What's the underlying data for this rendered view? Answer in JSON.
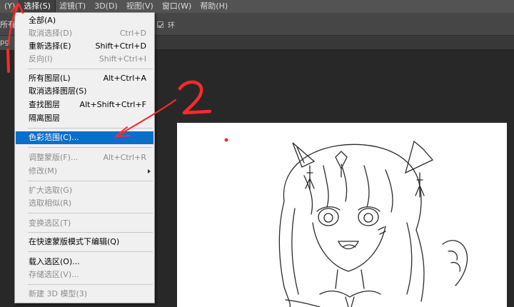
{
  "menubar": {
    "items": [
      "(Y)",
      "选择(S)",
      "滤镜(T)",
      "3D(D)",
      "视图(V)",
      "窗口(W)",
      "帮助(H)"
    ],
    "active_index": 1
  },
  "options_bar": {
    "left_text": "所有",
    "right_text": "环"
  },
  "tab": {
    "label": "pg @"
  },
  "select_menu": {
    "items": [
      {
        "label": "全部(A)",
        "shortcut": "",
        "disabled": false
      },
      {
        "label": "取消选择(D)",
        "shortcut": "Ctrl+D",
        "disabled": true
      },
      {
        "label": "重新选择(E)",
        "shortcut": "Shift+Ctrl+D",
        "disabled": false
      },
      {
        "label": "反向(I)",
        "shortcut": "Shift+Ctrl+I",
        "disabled": true
      },
      {
        "label": "所有图层(L)",
        "shortcut": "Alt+Ctrl+A",
        "disabled": false
      },
      {
        "label": "取消选择图层(S)",
        "shortcut": "",
        "disabled": false
      },
      {
        "label": "查找图层",
        "shortcut": "Alt+Shift+Ctrl+F",
        "disabled": false
      },
      {
        "label": "隔离图层",
        "shortcut": "",
        "disabled": false
      },
      {
        "label": "色彩范围(C)...",
        "shortcut": "",
        "disabled": false,
        "highlighted": true
      },
      {
        "label": "调整蒙版(F)...",
        "shortcut": "Alt+Ctrl+R",
        "disabled": true
      },
      {
        "label": "修改(M)",
        "shortcut": "",
        "disabled": true,
        "submenu": true
      },
      {
        "label": "扩大选取(G)",
        "shortcut": "",
        "disabled": true
      },
      {
        "label": "选取相似(R)",
        "shortcut": "",
        "disabled": true
      },
      {
        "label": "变换选区(T)",
        "shortcut": "",
        "disabled": true
      },
      {
        "label": "在快速蒙版模式下编辑(Q)",
        "shortcut": "",
        "disabled": false
      },
      {
        "label": "载入选区(O)...",
        "shortcut": "",
        "disabled": false
      },
      {
        "label": "存储选区(V)...",
        "shortcut": "",
        "disabled": true
      },
      {
        "label": "新建 3D 模型(3)",
        "shortcut": "",
        "disabled": true
      }
    ]
  },
  "annotations": {
    "step_1": "1",
    "step_2": "2",
    "annotation_color": "#ff2a2a"
  },
  "colors": {
    "menubar_bg": "#535353",
    "menu_highlight": "#0a6fc9",
    "canvas_bg": "#ffffff"
  }
}
